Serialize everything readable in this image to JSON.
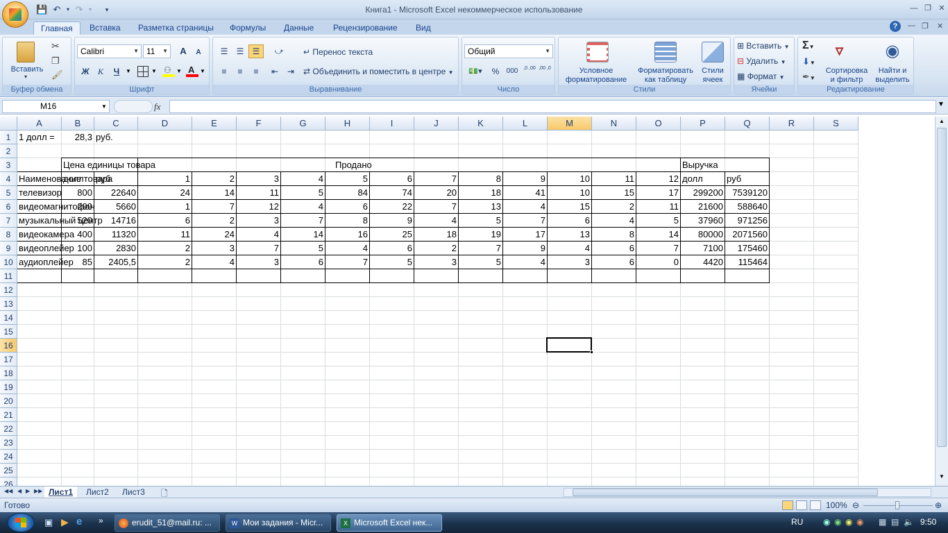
{
  "app": {
    "title": "Книга1 - Microsoft Excel некоммерческое использование",
    "qat": {
      "save_icon": "save-icon",
      "undo_icon": "undo-icon",
      "redo_icon": "redo-icon"
    }
  },
  "tabs": [
    "Главная",
    "Вставка",
    "Разметка страницы",
    "Формулы",
    "Данные",
    "Рецензирование",
    "Вид"
  ],
  "ribbon": {
    "clipboard": {
      "label": "Буфер обмена",
      "paste": "Вставить"
    },
    "font": {
      "label": "Шрифт",
      "name": "Calibri",
      "size": "11",
      "bold": "Ж",
      "italic": "К",
      "underline": "Ч",
      "grow": "A",
      "shrink": "A"
    },
    "alignment": {
      "label": "Выравнивание",
      "wrap": "Перенос текста",
      "merge": "Объединить и поместить в центре"
    },
    "number": {
      "label": "Число",
      "format": "Общий",
      "percent": "%",
      "thousands": "000",
      "inc_decimal": ",0 ,00",
      "dec_decimal": ",00 ,0"
    },
    "styles": {
      "label": "Стили",
      "conditional": [
        "Условное",
        "форматирование"
      ],
      "as_table": [
        "Форматировать",
        "как таблицу"
      ],
      "cell_styles": [
        "Стили",
        "ячеек"
      ]
    },
    "cells": {
      "label": "Ячейки",
      "insert": "Вставить",
      "delete": "Удалить",
      "format": "Формат"
    },
    "editing": {
      "label": "Редактирование",
      "sigma": "Σ",
      "sort": [
        "Сортировка",
        "и фильтр"
      ],
      "find": [
        "Найти и",
        "выделить"
      ]
    }
  },
  "formula_bar": {
    "name_box": "M16",
    "fx": "fx",
    "formula": ""
  },
  "columns": [
    "A",
    "B",
    "C",
    "D",
    "E",
    "F",
    "G",
    "H",
    "I",
    "J",
    "K",
    "L",
    "M",
    "N",
    "O",
    "P",
    "Q",
    "R",
    "S"
  ],
  "rows": [
    "1",
    "2",
    "3",
    "4",
    "5",
    "6",
    "7",
    "8",
    "9",
    "10",
    "11",
    "12",
    "13",
    "14",
    "15",
    "16",
    "17",
    "18",
    "19",
    "20",
    "21",
    "22",
    "23",
    "24",
    "25",
    "26"
  ],
  "selected_cell": {
    "col": "M",
    "row": "16"
  },
  "cells": {
    "A1": "1 долл =",
    "B1": "28,3",
    "C1": "руб.",
    "B3": "Цена единицы товара",
    "H3": "Продано",
    "P3": "Выручка",
    "A4": "Наименование товара",
    "B4": "долл",
    "C4": "руб",
    "D4": "1",
    "E4": "2",
    "F4": "3",
    "G4": "4",
    "H4": "5",
    "I4": "6",
    "J4": "7",
    "K4": "8",
    "L4": "9",
    "M4": "10",
    "N4": "11",
    "O4": "12",
    "P4": "долл",
    "Q4": "руб",
    "A5": "телевизор",
    "B5": "800",
    "C5": "22640",
    "D5": "24",
    "E5": "14",
    "F5": "11",
    "G5": "5",
    "H5": "84",
    "I5": "74",
    "J5": "20",
    "K5": "18",
    "L5": "41",
    "M5": "10",
    "N5": "15",
    "O5": "17",
    "P5": "299200",
    "Q5": "7539120",
    "A6": "видеомагнитофон",
    "B6": "200",
    "C6": "5660",
    "D6": "1",
    "E6": "7",
    "F6": "12",
    "G6": "4",
    "H6": "6",
    "I6": "22",
    "J6": "7",
    "K6": "13",
    "L6": "4",
    "M6": "15",
    "N6": "2",
    "O6": "11",
    "P6": "21600",
    "Q6": "588640",
    "A7": "музыкальный центр",
    "B7": "520",
    "C7": "14716",
    "D7": "6",
    "E7": "2",
    "F7": "3",
    "G7": "7",
    "H7": "8",
    "I7": "9",
    "J7": "4",
    "K7": "5",
    "L7": "7",
    "M7": "6",
    "N7": "4",
    "O7": "5",
    "P7": "37960",
    "Q7": "971256",
    "A8": "видеокамера",
    "B8": "400",
    "C8": "11320",
    "D8": "11",
    "E8": "24",
    "F8": "4",
    "G8": "14",
    "H8": "16",
    "I8": "25",
    "J8": "18",
    "K8": "19",
    "L8": "17",
    "M8": "13",
    "N8": "8",
    "O8": "14",
    "P8": "80000",
    "Q8": "2071560",
    "A9": "видеоплейер",
    "B9": "100",
    "C9": "2830",
    "D9": "2",
    "E9": "3",
    "F9": "7",
    "G9": "5",
    "H9": "4",
    "I9": "6",
    "J9": "2",
    "K9": "7",
    "L9": "9",
    "M9": "4",
    "N9": "6",
    "O9": "7",
    "P9": "7100",
    "Q9": "175460",
    "A10": "аудиоплейер",
    "B10": "85",
    "C10": "2405,5",
    "D10": "2",
    "E10": "4",
    "F10": "3",
    "G10": "6",
    "H10": "7",
    "I10": "5",
    "J10": "3",
    "K10": "5",
    "L10": "4",
    "M10": "3",
    "N10": "6",
    "O10": "0",
    "P10": "4420",
    "Q10": "115464"
  },
  "sheets": [
    "Лист1",
    "Лист2",
    "Лист3"
  ],
  "active_sheet": "Лист1",
  "status": {
    "ready": "Готово",
    "zoom": "100%"
  },
  "taskbar": {
    "items": [
      "erudit_51@mail.ru: ...",
      "Мои задания - Micr...",
      "Microsoft Excel нек..."
    ],
    "lang": "RU",
    "clock": "9:50"
  }
}
